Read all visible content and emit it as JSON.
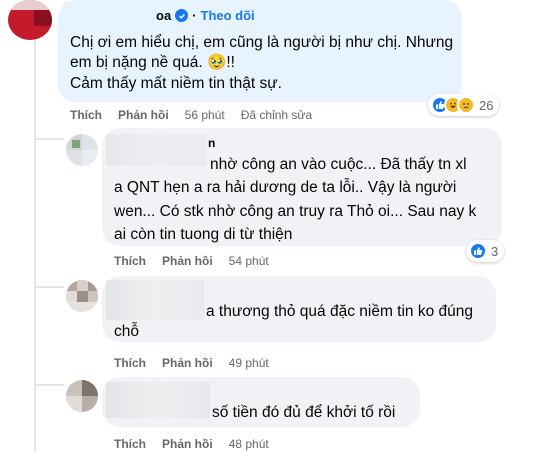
{
  "comment_main": {
    "author_visible": "oa",
    "follow_label": "Theo dõi",
    "lines": [
      "Chị ơi em hiểu chị, em cũng là người bị như chị. Nhưng",
      "em bị nặng nề quá. 🥹!!",
      "Cảm thấy mất niềm tin thật sự."
    ],
    "actions": {
      "like": "Thích",
      "reply": "Phản hồi",
      "time": "56 phút",
      "edited": "Đã chỉnh sửa"
    },
    "reactions": {
      "icons": [
        "like-reaction-icon",
        "haha-reaction-icon",
        "sad-reaction-icon"
      ],
      "count": "26"
    }
  },
  "replies": [
    {
      "author_visible": "n",
      "lines": [
        "nhờ công an vào cuộc... Đã thấy tn xl",
        "a QNT hẹn a ra hải dương de ta lỗi.. Vậy là người",
        "wen... Có stk nhờ công an truy ra Thỏ oi... Sau nay k",
        "ai còn tin tuong di từ thiện"
      ],
      "actions": {
        "like": "Thích",
        "reply": "Phản hồi",
        "time": "54 phút"
      },
      "reactions": {
        "icons": [
          "like-reaction-icon"
        ],
        "count": "3"
      }
    },
    {
      "lines": [
        "a thương thỏ quá đặc niềm tin ko đúng",
        "chỗ"
      ],
      "actions": {
        "like": "Thích",
        "reply": "Phản hồi",
        "time": "49 phút"
      }
    },
    {
      "lines": [
        "số tiền đó đủ để khởi tố rồi"
      ],
      "actions": {
        "like": "Thích",
        "reply": "Phản hồi",
        "time": "48 phút"
      }
    }
  ],
  "colors": {
    "accent": "#1877f2",
    "first_bubble": "#e7f3ff",
    "reply_bubble": "#f0f2f5",
    "meta_text": "#65676b"
  }
}
